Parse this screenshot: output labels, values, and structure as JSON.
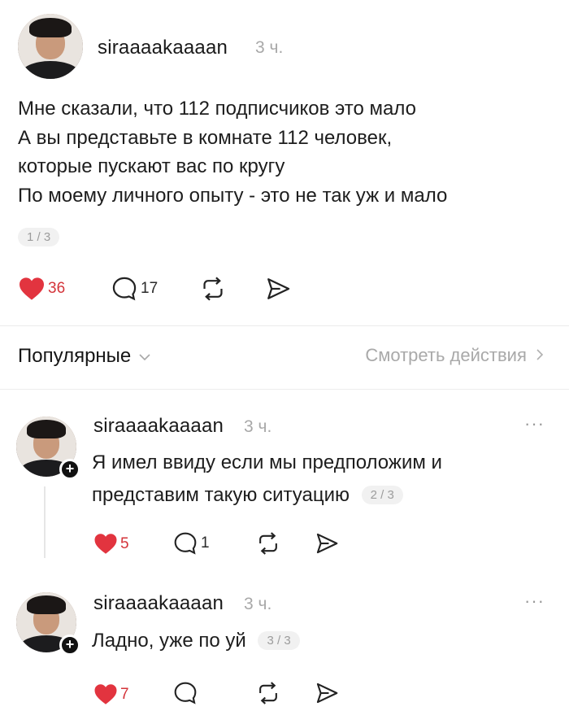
{
  "post": {
    "username": "siraaaakaaaan",
    "time": "3 ч.",
    "lines": [
      "Мне сказали, что 112 подписчиков это мало",
      "А вы представьте в комнате 112 человек,",
      "которые пускают вас по кругу",
      "По моему личного опыту - это не так уж и мало"
    ],
    "page": "1 / 3",
    "likes": "36",
    "comments": "17"
  },
  "section": {
    "title": "Популярные",
    "link": "Смотреть действия"
  },
  "replies": [
    {
      "username": "siraaaakaaaan",
      "time": "3 ч.",
      "lines": [
        "Я имел ввиду если мы предположим и",
        "представим такую ситуацию"
      ],
      "page": "2 / 3",
      "likes": "5",
      "comments": "1"
    },
    {
      "username": "siraaaakaaaan",
      "time": "3 ч.",
      "lines": [
        "Ладно, уже по уй"
      ],
      "page": "3 / 3",
      "likes": "7",
      "comments": ""
    }
  ],
  "icons": {
    "like": "heart-icon",
    "comment": "comment-bubble-icon",
    "repost": "repost-icon",
    "share": "send-icon",
    "more": "more-dots-icon",
    "follow": "plus-icon"
  },
  "colors": {
    "like": "#e2343f",
    "muted": "#a8a8a8",
    "text": "#1d1d1d"
  }
}
